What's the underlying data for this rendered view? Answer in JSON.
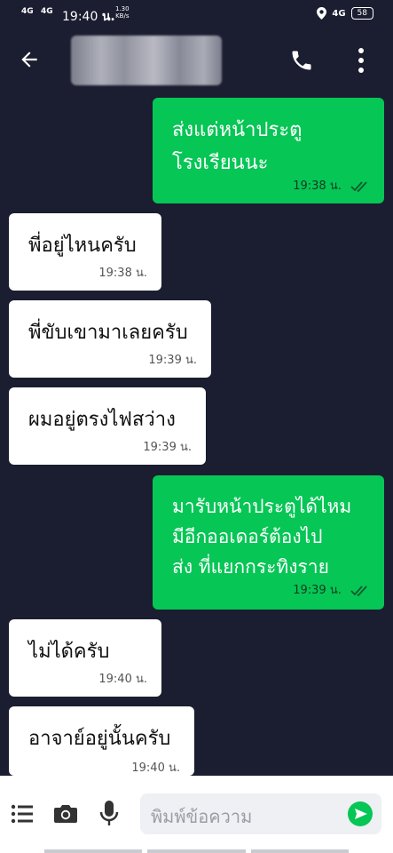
{
  "status_bar": {
    "signal1": "4G",
    "signal2": "4G",
    "time": "19:40",
    "carrier": "น.",
    "speed_value": "1.30",
    "speed_unit": "KB/s",
    "network": "4G",
    "battery": "58"
  },
  "header": {
    "contact_name": "",
    "back_icon": "arrow-left",
    "call_icon": "phone",
    "menu_icon": "more-vertical"
  },
  "messages": [
    {
      "direction": "outgoing",
      "lines": [
        "ส่งแต่หน้าประตู",
        "โรงเรียนนะ"
      ],
      "time": "19:38 น.",
      "read": true
    },
    {
      "direction": "incoming",
      "lines": [
        "พี่อยู่ไหนครับ"
      ],
      "time": "19:38 น."
    },
    {
      "direction": "incoming",
      "lines": [
        "พี่ขับเขามาเลยครับ"
      ],
      "time": "19:39 น."
    },
    {
      "direction": "incoming",
      "lines": [
        "ผมอยู่ตรงไฟสว่าง"
      ],
      "time": "19:39 น."
    },
    {
      "direction": "outgoing",
      "lines": [
        "มารับหน้าประตูได้ไหม",
        "มีอีกออเดอร์ต้องไป",
        "ส่ง ที่แยกกระทิงราย"
      ],
      "time": "19:39 น.",
      "read": true
    },
    {
      "direction": "incoming",
      "lines": [
        "ไม่ได้ครับ"
      ],
      "time": "19:40 น."
    },
    {
      "direction": "incoming",
      "lines": [
        "อาจาย์อยู่นั้นครับ"
      ],
      "time": "19:40 น."
    }
  ],
  "composer": {
    "placeholder": "พิมพ์ข้อความ",
    "menu_icon": "list",
    "camera_icon": "camera",
    "mic_icon": "microphone",
    "send_icon": "send"
  },
  "colors": {
    "chat_bg": "#1b1d30",
    "outgoing_bubble": "#06c655",
    "incoming_bubble": "#ffffff"
  }
}
